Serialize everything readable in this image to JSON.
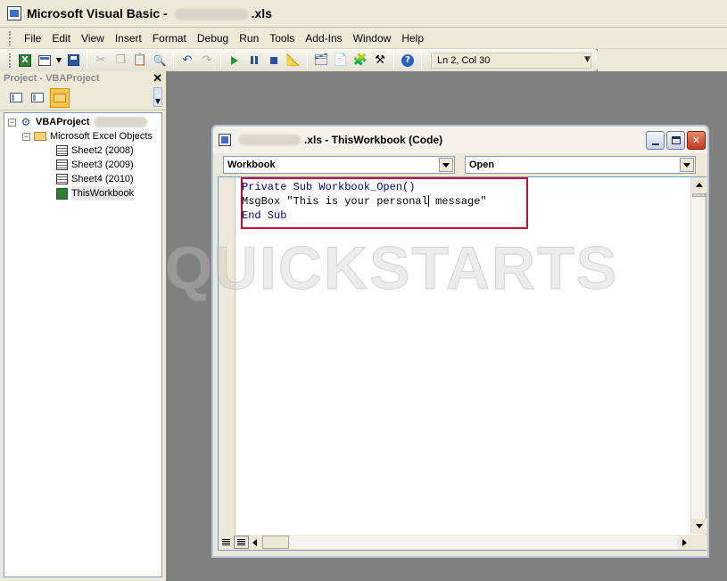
{
  "window": {
    "title_prefix": "Microsoft Visual Basic -",
    "title_suffix": ".xls"
  },
  "menu": [
    {
      "label": "File"
    },
    {
      "label": "Edit"
    },
    {
      "label": "View"
    },
    {
      "label": "Insert"
    },
    {
      "label": "Format"
    },
    {
      "label": "Debug"
    },
    {
      "label": "Run"
    },
    {
      "label": "Tools"
    },
    {
      "label": "Add-Ins"
    },
    {
      "label": "Window"
    },
    {
      "label": "Help"
    }
  ],
  "toolbar": {
    "position_text": "Ln 2, Col 30",
    "icons": [
      "excel-icon",
      "insert-userform-icon",
      "save-icon",
      "cut-icon",
      "copy-icon",
      "paste-icon",
      "find-icon",
      "undo-icon",
      "redo-icon",
      "run-icon",
      "break-icon",
      "reset-icon",
      "design-mode-icon",
      "project-explorer-icon",
      "properties-icon",
      "object-browser-icon",
      "toolbox-icon",
      "help-icon"
    ]
  },
  "project_panel": {
    "title": "Project - VBAProject",
    "tree": {
      "root": "VBAProject",
      "folder": "Microsoft Excel Objects",
      "items": [
        {
          "label": "Sheet2 (2008)"
        },
        {
          "label": "Sheet3 (2009)"
        },
        {
          "label": "Sheet4 (2010)"
        },
        {
          "label": "ThisWorkbook"
        }
      ]
    }
  },
  "code_window": {
    "title_suffix": ".xls - ThisWorkbook (Code)",
    "object_combo": "Workbook",
    "procedure_combo": "Open",
    "code_lines": [
      "Private Sub Workbook_Open()",
      "MsgBox \"This is your personal",
      " message\"",
      "End Sub"
    ]
  },
  "watermark": "QUICKSTARTS"
}
